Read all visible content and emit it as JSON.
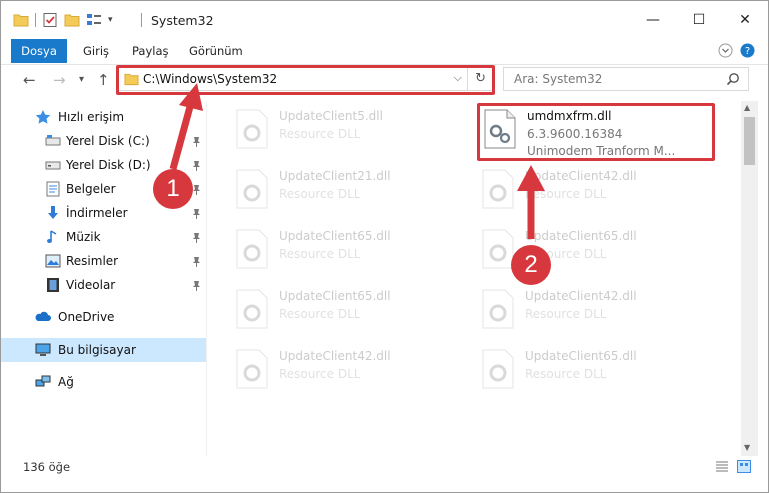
{
  "window": {
    "title": "System32",
    "controls": {
      "minimize": "—",
      "maximize": "☐",
      "close": "✕"
    }
  },
  "ribbon": {
    "tabs": [
      "Dosya",
      "Giriş",
      "Paylaş",
      "Görünüm"
    ],
    "expand_icon": "chevron-down-icon",
    "help_icon": "help-icon"
  },
  "address_bar": {
    "path": "C:\\Windows\\System32",
    "dropdown_glyph": "⌵",
    "refresh_glyph": "↻"
  },
  "navigation": {
    "back": "←",
    "forward": "→",
    "recent": "▾",
    "up": "↑"
  },
  "search": {
    "placeholder": "Ara: System32"
  },
  "sidebar": {
    "quick_access": "Hızlı erişim",
    "items": [
      {
        "label": "Yerel Disk (C:)",
        "icon": "drive-icon"
      },
      {
        "label": "Yerel Disk (D:)",
        "icon": "drive-icon"
      },
      {
        "label": "Belgeler",
        "icon": "documents-icon"
      },
      {
        "label": "İndirmeler",
        "icon": "downloads-icon"
      },
      {
        "label": "Müzik",
        "icon": "music-icon"
      },
      {
        "label": "Resimler",
        "icon": "pictures-icon"
      },
      {
        "label": "Videolar",
        "icon": "videos-icon"
      }
    ],
    "onedrive": "OneDrive",
    "this_pc": "Bu bilgisayar",
    "network": "Ağ"
  },
  "files": {
    "highlighted": {
      "name": "umdmxfrm.dll",
      "version": "6.3.9600.16384",
      "description": "Unimodem Tranform M..."
    },
    "items": [
      {
        "name": "UpdateClient5.dll",
        "type": "Resource DLL"
      },
      {
        "name": "UpdateClient21.dll",
        "type": "Resource DLL"
      },
      {
        "name": "UpdateClient42.dll",
        "type": "Resource DLL"
      },
      {
        "name": "UpdateClient65.dll",
        "type": "Resource DLL"
      },
      {
        "name": "UpdateClient65.dll",
        "type": "Resource DLL"
      },
      {
        "name": "UpdateClient65.dll",
        "type": "Resource DLL"
      },
      {
        "name": "UpdateClient42.dll",
        "type": "Resource DLL"
      },
      {
        "name": "UpdateClient42.dll",
        "type": "Resource DLL"
      },
      {
        "name": "UpdateClient65.dll",
        "type": "Resource DLL"
      }
    ]
  },
  "status_bar": {
    "count": "136 öğe"
  },
  "annotations": {
    "step1": "1",
    "step2": "2",
    "color": "#d7383e"
  }
}
